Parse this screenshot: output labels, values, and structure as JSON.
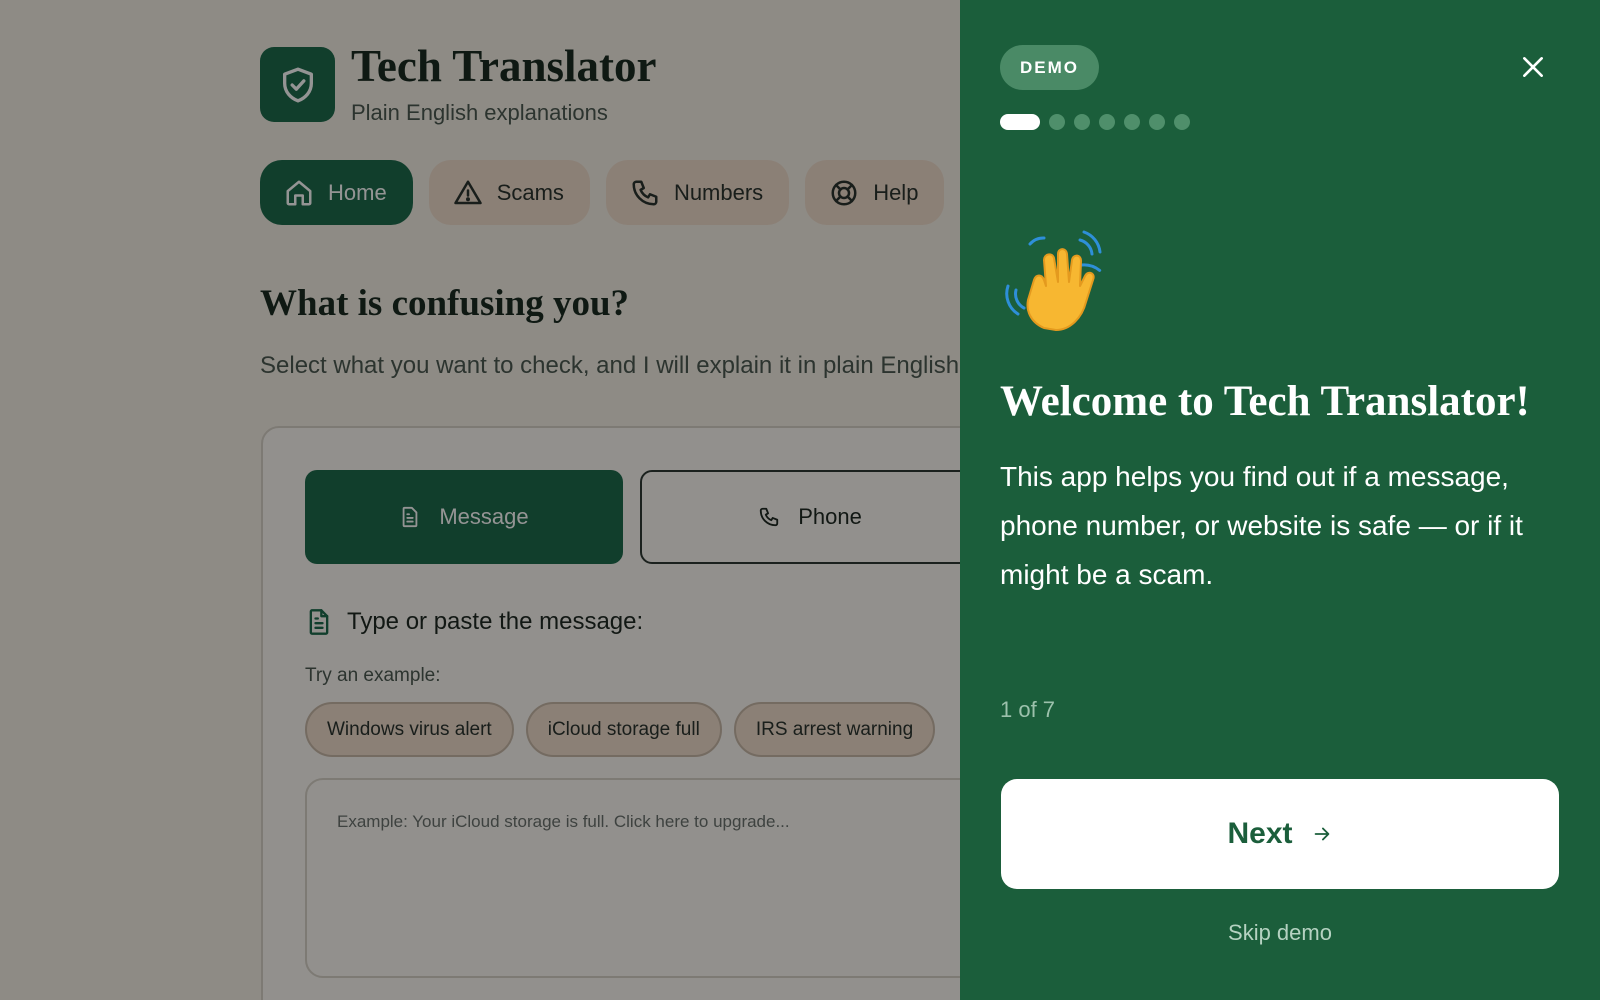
{
  "app": {
    "title": "Tech Translator",
    "subtitle": "Plain English explanations",
    "nav": [
      {
        "label": "Home",
        "icon": "home-icon",
        "active": true
      },
      {
        "label": "Scams",
        "icon": "warning-icon",
        "active": false
      },
      {
        "label": "Numbers",
        "icon": "phone-icon",
        "active": false
      },
      {
        "label": "Help",
        "icon": "lifebuoy-icon",
        "active": false
      }
    ],
    "question": "What is confusing you?",
    "question_sub": "Select what you want to check, and I will explain it in plain English.",
    "types": {
      "message": "Message",
      "phone": "Phone"
    },
    "field_label": "Type or paste the message:",
    "example_label": "Try an example:",
    "examples": [
      "Windows virus alert",
      "iCloud storage full",
      "IRS arrest warning"
    ],
    "textarea_placeholder": "Example: Your iCloud storage is full. Click here to upgrade..."
  },
  "demo": {
    "badge": "DEMO",
    "step_current": 1,
    "step_total": 7,
    "title": "Welcome to Tech Translator!",
    "body": "This app helps you find out if a message, phone number, or website is safe — or if it might be a scam.",
    "counter": "1 of 7",
    "next_label": "Next",
    "skip_label": "Skip demo"
  },
  "colors": {
    "brand": "#1e6b4d",
    "panel": "#1b5e3b",
    "chip": "#f0dccb",
    "background": "#f5efe6"
  }
}
